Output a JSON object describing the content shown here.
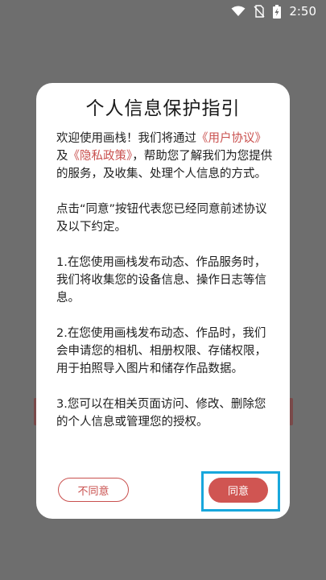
{
  "status_bar": {
    "time": "2:50",
    "icons": [
      "wifi-icon",
      "no-sim-icon",
      "battery-charging-icon"
    ]
  },
  "dialog": {
    "title": "个人信息保护指引",
    "paragraph1": {
      "part1": "欢迎使用画栈！我们将通过",
      "link_user_agreement": "《用户协议》",
      "part2": "及",
      "link_privacy_policy": "《隐私政策》",
      "part3": "，帮助您了解我们为您提供的服务，及收集、处理个人信息的方式。"
    },
    "paragraph2": "点击“同意”按钮代表您已经同意前述协议及以下约定。",
    "paragraph3": "1.在您使用画栈发布动态、作品服务时，我们将收集您的设备信息、操作日志等信息。",
    "paragraph4": "2.在您使用画栈发布动态、作品时，我们会申请您的相机、相册权限、存储权限，用于拍照导入图片和储存作品数据。",
    "paragraph5": "3.您可以在相关页面访问、修改、删除您的个人信息或管理您的授权。",
    "disagree_label": "不同意",
    "agree_label": "同意"
  },
  "colors": {
    "overlay": "#6e6e6e",
    "accent": "#d05552",
    "link": "#c9504e",
    "highlight": "#18a7dc"
  }
}
